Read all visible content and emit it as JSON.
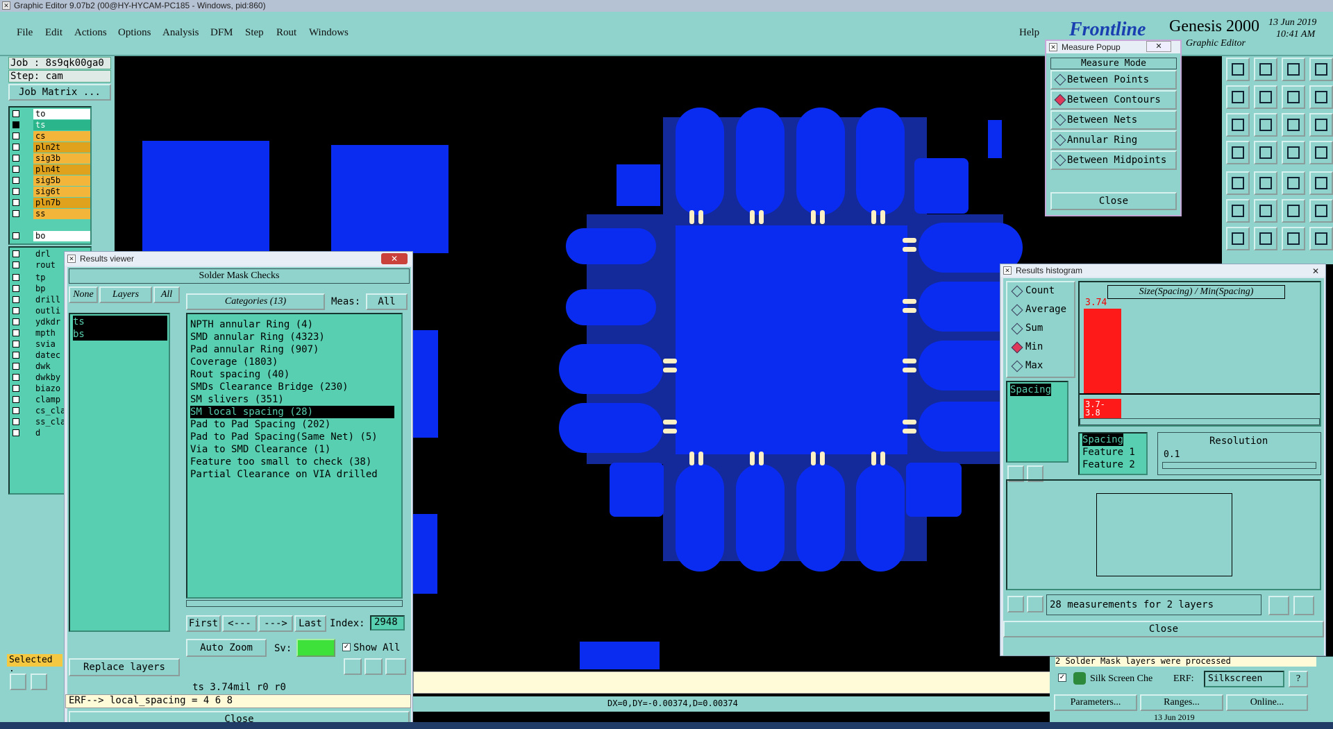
{
  "window": {
    "title": "Graphic Editor 9.07b2 (00@HY-HYCAM-PC185 - Windows, pid:860)"
  },
  "menu": [
    "File",
    "Edit",
    "Actions",
    "Options",
    "Analysis",
    "DFM",
    "Step",
    "Rout",
    "Windows"
  ],
  "help": "Help",
  "brand": {
    "logo": "Frontline",
    "product": "Genesis 2000",
    "subtitle": "Graphic Editor",
    "date": "13 Jun 2019",
    "time": "10:41 AM"
  },
  "job": {
    "job": "Job : 8s9qk00ga0",
    "step": "Step: cam",
    "matrix": "Job Matrix ..."
  },
  "layers_top": [
    "to",
    "ts",
    "cs",
    "pln2t",
    "sig3b",
    "pln4t",
    "sig5b",
    "sig6t",
    "pln7b",
    "ss",
    "bo"
  ],
  "layers_bottom": [
    "drl",
    "rout",
    "tp",
    "bp",
    "drill",
    "outli",
    "ydkdr",
    "mpth",
    "svia",
    "datec",
    "dwk",
    "dwkby",
    "biazo",
    "clamp",
    "cs_cla",
    "ss_cla",
    "d"
  ],
  "selected": "Selected :",
  "results_viewer": {
    "title": "Results viewer",
    "header": "Solder Mask Checks",
    "none": "None",
    "layers": "Layers",
    "all": "All",
    "categories_label": "Categories (13)",
    "meas_label": "Meas:",
    "meas_value": "All",
    "layer_list": [
      "ts",
      "bs"
    ],
    "categories": [
      "NPTH annular Ring (4)",
      "SMD annular Ring (4323)",
      "Pad annular Ring (907)",
      "Coverage (1803)",
      "Rout spacing (40)",
      "SMDs Clearance Bridge (230)",
      "SM slivers (351)",
      "SM local spacing (28)",
      "Pad to Pad Spacing (202)",
      "Pad to Pad Spacing(Same Net) (5)",
      "Via to SMD Clearance (1)",
      "Feature too small to check (38)",
      "Partial Clearance on VIA drilled"
    ],
    "selected_index": 7,
    "first": "First",
    "prev": "<---",
    "next": "--->",
    "last": "Last",
    "index_label": "Index:",
    "index_value": "2948",
    "auto_zoom": "Auto Zoom",
    "sv": "Sv:",
    "show_all": "Show All",
    "replace_layers": "Replace layers",
    "status": "ts 3.74mil  r0  r0",
    "close": "Close"
  },
  "erf_line": "ERF--> local_spacing = 4 6 8",
  "coords": "DX=0,DY=-0.00374,D=0.00374",
  "measure_popup": {
    "title": "Measure Popup",
    "heading": "Measure Mode",
    "modes": [
      "Between Points",
      "Between Contours",
      "Between Nets",
      "Annular Ring",
      "Between Midpoints"
    ],
    "selected": 1,
    "close": "Close"
  },
  "histogram": {
    "title": "Results histogram",
    "options": [
      "Count",
      "Average",
      "Sum",
      "Min",
      "Max"
    ],
    "selected": 3,
    "list": [
      "Spacing"
    ],
    "chart_title": "Size(Spacing) / Min(Spacing)",
    "bar_value": "3.74",
    "bar_label": "3.7-\n3.8",
    "fields": [
      "Spacing",
      "Feature 1",
      "Feature 2"
    ],
    "resolution_label": "Resolution",
    "resolution_value": "0.1",
    "summary": "28 measurements for 2 layers",
    "close": "Close"
  },
  "bottom_right": {
    "msg": "2 Solder Mask layers were processed",
    "check": "Silk Screen Che",
    "erf": "ERF:",
    "erf_value": "Silkscreen",
    "help": "?",
    "params": "Parameters...",
    "ranges": "Ranges...",
    "online": "Online...",
    "date": "13 Jun 2019"
  },
  "colors": {
    "panel": "#8fd3cc",
    "teal": "#58cfb0",
    "pad": "#0a2cf0",
    "bar": "#ff1a1a"
  }
}
